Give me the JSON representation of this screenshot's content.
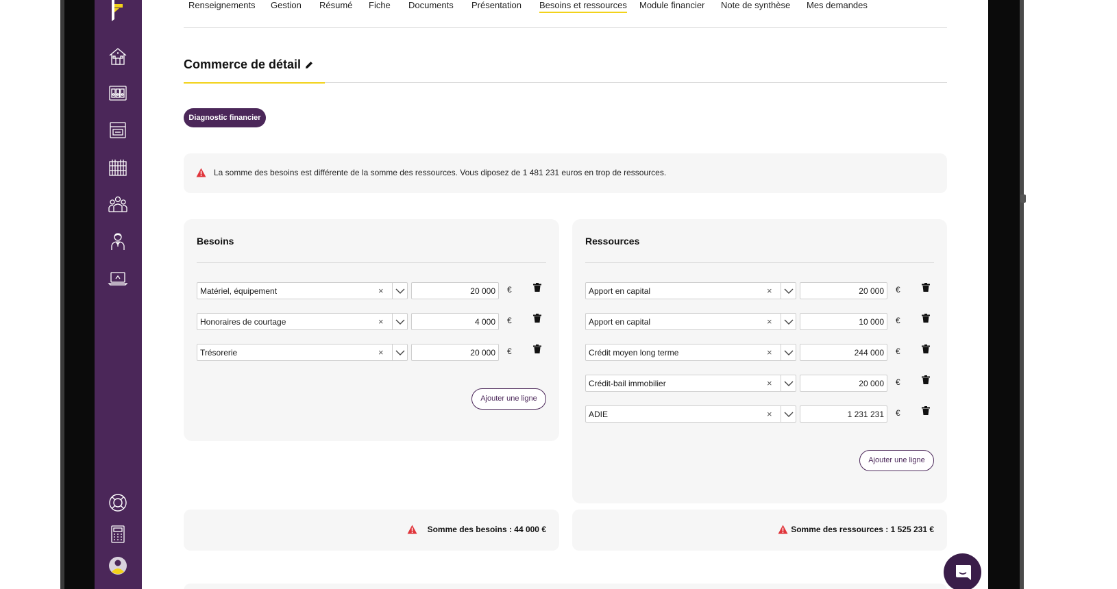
{
  "tabs": [
    {
      "label": "Renseignements"
    },
    {
      "label": "Gestion"
    },
    {
      "label": "Résumé"
    },
    {
      "label": "Fiche"
    },
    {
      "label": "Documents"
    },
    {
      "label": "Présentation"
    },
    {
      "label": "Besoins et ressources",
      "active": true
    },
    {
      "label": "Module financier"
    },
    {
      "label": "Note de synthèse"
    },
    {
      "label": "Mes demandes"
    }
  ],
  "section": {
    "title": "Commerce de détail"
  },
  "diagnostic_button": "Diagnostic financier",
  "alert": {
    "message": "La somme des besoins est différente de la somme des ressources. Vous diposez de 1 481 231 euros en trop de ressources."
  },
  "besoins": {
    "title": "Besoins",
    "rows": [
      {
        "label": "Matériel, équipement",
        "amount": "20 000",
        "currency": "€"
      },
      {
        "label": "Honoraires de courtage",
        "amount": "4 000",
        "currency": "€"
      },
      {
        "label": "Trésorerie",
        "amount": "20 000",
        "currency": "€"
      }
    ],
    "add_label": "Ajouter une ligne",
    "total": "Somme des besoins : 44 000 €"
  },
  "ressources": {
    "title": "Ressources",
    "rows": [
      {
        "label": "Apport en capital",
        "amount": "20 000",
        "currency": "€"
      },
      {
        "label": "Apport en capital",
        "amount": "10 000",
        "currency": "€"
      },
      {
        "label": "Crédit moyen long terme",
        "amount": "244 000",
        "currency": "€"
      },
      {
        "label": "Crédit-bail immobilier",
        "amount": "20 000",
        "currency": "€"
      },
      {
        "label": "ADIE",
        "amount": "1 231 231",
        "currency": "€"
      }
    ],
    "add_label": "Ajouter une ligne",
    "total": "Somme des ressources : 1 525 231 €"
  },
  "icons": {
    "sidebar": [
      "logo-icon",
      "home-icon",
      "dashboard-icon",
      "archive-icon",
      "library-icon",
      "team-icon",
      "advisor-icon",
      "laptop-icon",
      "support-icon",
      "calculator-icon",
      "user-avatar-icon"
    ],
    "row": [
      "clear-icon",
      "chevron-down-icon",
      "trash-icon"
    ],
    "alert": "warning-icon",
    "chat": "chat-icon"
  },
  "colors": {
    "brand": "#4b2759",
    "accent": "#f2d21a",
    "warning": "#e0353b",
    "panel": "#f6f6f6"
  }
}
